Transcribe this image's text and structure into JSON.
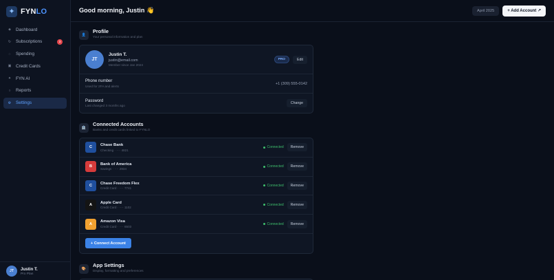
{
  "app": {
    "logo_prefix": "FYN",
    "logo_suffix": "LO",
    "logo_icon": "sparkle-icon"
  },
  "sidebar": {
    "items": [
      {
        "label": "Dashboard",
        "icon": "grid-icon",
        "glyph": "◈",
        "active": false
      },
      {
        "label": "Subscriptions",
        "icon": "repeat-icon",
        "glyph": "↻",
        "active": false,
        "badge": "3"
      },
      {
        "label": "Spending",
        "icon": "chart-icon",
        "glyph": "◌",
        "active": false
      },
      {
        "label": "Credit Cards",
        "icon": "card-icon",
        "glyph": "▣",
        "active": false
      },
      {
        "label": "FYN AI",
        "icon": "sparkle-icon",
        "glyph": "✦",
        "active": false
      },
      {
        "label": "Reports",
        "icon": "doc-icon",
        "glyph": "○",
        "active": false
      },
      {
        "label": "Settings",
        "icon": "gear-icon",
        "glyph": "⚙",
        "active": true
      }
    ]
  },
  "user": {
    "initials": "JT",
    "name": "Justin T.",
    "plan": "Pro Plan"
  },
  "header": {
    "greeting": "Good morning, Justin 👋",
    "date": "April 2025",
    "add_account": "+ Add Account ↗"
  },
  "profile": {
    "title": "Profile",
    "subtitle": "Your personal information and plan",
    "initials": "JT",
    "name": "Justin T.",
    "email": "justin@email.com",
    "member_since": "Member since Jan 2024",
    "badge": "PRO",
    "edit": "Edit",
    "phone_label": "Phone number",
    "phone_sub": "Used for 2FA and alerts",
    "phone_value": "+1 (309) 555-0142",
    "password_label": "Password",
    "password_sub": "Last changed 3 months ago",
    "password_action": "Change"
  },
  "connected": {
    "title": "Connected Accounts",
    "subtitle": "Banks and credit cards linked to FYNLO",
    "status_label": "Connected",
    "remove_label": "Remove",
    "accounts": [
      {
        "letter": "C",
        "name": "Chase Bank",
        "detail": "Checking · ···· 4821",
        "color": "#1f4f9e"
      },
      {
        "letter": "B",
        "name": "Bank of America",
        "detail": "Savings · ···· 2934",
        "color": "#d63b3b"
      },
      {
        "letter": "C",
        "name": "Chase Freedom Flex",
        "detail": "Credit Card · ···· 7741",
        "color": "#1f4f9e"
      },
      {
        "letter": "A",
        "name": "Apple Card",
        "detail": "Credit Card · ···· 1102",
        "color": "#141414"
      },
      {
        "letter": "A",
        "name": "Amazon Visa",
        "detail": "Credit Card · ···· 6503",
        "color": "#f0a030"
      }
    ],
    "connect_button": "+ Connect Account"
  },
  "app_settings": {
    "title": "App Settings",
    "subtitle": "Display, formatting and preferences"
  }
}
